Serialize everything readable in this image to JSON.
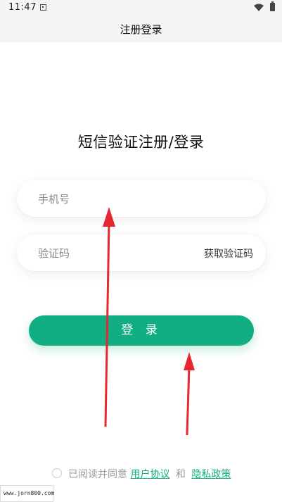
{
  "status_bar": {
    "time": "11:47"
  },
  "nav": {
    "title": "注册登录"
  },
  "login": {
    "heading": "短信验证注册/登录",
    "phone_placeholder": "手机号",
    "code_placeholder": "验证码",
    "get_code_label": "获取验证码",
    "login_button_label": "登 录"
  },
  "agreement": {
    "prefix": "已阅读并同意",
    "user_agreement": "用户协议",
    "and": "和",
    "privacy_policy": "隐私政策"
  },
  "watermark": {
    "text": "www.jorn800.com"
  },
  "colors": {
    "accent": "#12ae83",
    "annotation_arrow": "#e8262f"
  }
}
